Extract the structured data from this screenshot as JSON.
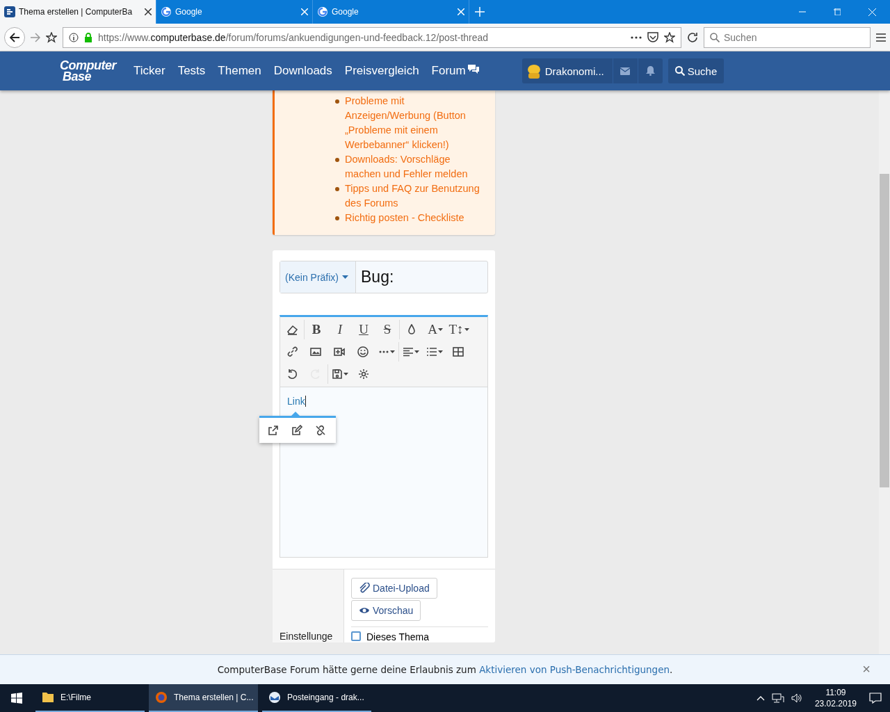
{
  "browser": {
    "tabs": [
      {
        "title": "Thema erstellen | ComputerBa",
        "selected": true
      },
      {
        "title": "Google",
        "selected": false
      },
      {
        "title": "Google",
        "selected": false
      }
    ],
    "url": {
      "scheme": "https://www.",
      "domain": "computerbase.de",
      "path": "/forum/forums/ankuendigungen-und-feedback.12/post-thread"
    },
    "search": {
      "placeholder": "Suchen"
    }
  },
  "site": {
    "logo": [
      "Computer",
      "Base"
    ],
    "nav": [
      {
        "label": "Ticker",
        "new_posts": false
      },
      {
        "label": "Tests",
        "new_posts": false
      },
      {
        "label": "Themen",
        "new_posts": false
      },
      {
        "label": "Downloads",
        "new_posts": false
      },
      {
        "label": "Preisvergleich",
        "new_posts": false
      },
      {
        "label": "Forum",
        "new_posts": true
      }
    ],
    "user": {
      "name": "Drakonomi..."
    },
    "search_button": "Suche"
  },
  "notice": {
    "items": [
      "Probleme mit Anzeigen/Werbung (Button „Probleme mit einem Werbebanner“ klicken!)",
      "Downloads: Vorschläge machen und Fehler melden",
      "Tipps und FAQ zur Benutzung des Forums",
      "Richtig posten - Checkliste"
    ]
  },
  "thread_form": {
    "prefix": "(Kein Präfix)",
    "title": "Bug:",
    "toolbar": [
      [
        [
          {
            "kind": "icon",
            "caret": false,
            "disabled": false
          }
        ],
        [
          {
            "kind": "label",
            "label": "B",
            "caret": false,
            "disabled": false
          },
          {
            "kind": "label",
            "label": "I",
            "caret": false,
            "disabled": false
          },
          {
            "kind": "label",
            "label": "U",
            "caret": false,
            "disabled": false
          },
          {
            "kind": "label",
            "label": "S",
            "caret": false,
            "disabled": false
          }
        ],
        [
          {
            "kind": "icon",
            "caret": false,
            "disabled": false
          },
          {
            "kind": "label",
            "label": "A",
            "caret": true,
            "disabled": false
          },
          {
            "kind": "label",
            "label": "T↕",
            "caret": true,
            "disabled": false
          }
        ]
      ],
      [
        [
          {
            "kind": "icon",
            "caret": false,
            "disabled": false
          },
          {
            "kind": "icon",
            "caret": false,
            "disabled": false
          },
          {
            "kind": "icon",
            "caret": false,
            "disabled": false
          },
          {
            "kind": "icon",
            "caret": false,
            "disabled": false
          },
          {
            "kind": "icon",
            "caret": true,
            "disabled": false
          }
        ],
        [
          {
            "kind": "icon",
            "caret": true,
            "disabled": false
          },
          {
            "kind": "icon",
            "caret": true,
            "disabled": false
          },
          {
            "kind": "icon",
            "caret": false,
            "disabled": false
          }
        ]
      ],
      [
        [
          {
            "kind": "icon",
            "caret": false,
            "disabled": false
          },
          {
            "kind": "icon",
            "caret": false,
            "disabled": true
          }
        ],
        [
          {
            "kind": "icon",
            "caret": true,
            "disabled": false
          },
          {
            "kind": "icon",
            "caret": false,
            "disabled": false
          }
        ]
      ]
    ],
    "content": "Link",
    "attach_buttons": [
      "Datei-Upload",
      "Vorschau"
    ],
    "settings": {
      "label": "Einstellunge",
      "option": "Dieses Thema",
      "checked": false
    }
  },
  "notification": {
    "before": "ComputerBase Forum hätte gerne deine Erlaubnis zum ",
    "link": "Aktivieren von Push-Benachrichtigungen",
    "after": ".",
    "close": "×"
  },
  "taskbar": {
    "items": [
      {
        "label": "E:\\Filme",
        "selected": false
      },
      {
        "label": "Thema erstellen | C...",
        "selected": true
      },
      {
        "label": "Posteingang - drak...",
        "selected": false
      }
    ],
    "time": "11:09",
    "date": "23.02.2019"
  }
}
